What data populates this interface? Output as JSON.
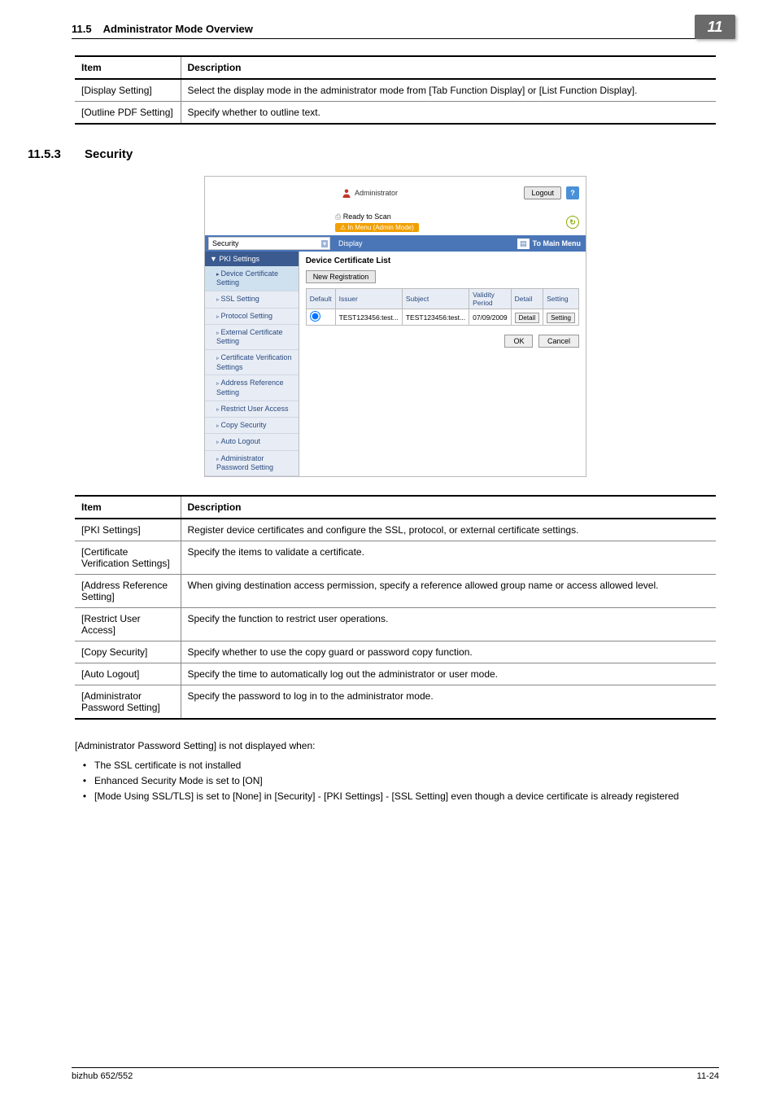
{
  "header": {
    "section_no": "11.5",
    "section_title": "Administrator Mode Overview",
    "chapter_badge": "11"
  },
  "table1": {
    "head": {
      "item": "Item",
      "desc": "Description"
    },
    "rows": [
      {
        "item": "[Display Setting]",
        "desc": "Select the display mode in the administrator mode from [Tab Function Display] or [List Function Display]."
      },
      {
        "item": "[Outline PDF Setting]",
        "desc": "Specify whether to outline text."
      }
    ]
  },
  "subsection": {
    "num": "11.5.3",
    "title": "Security"
  },
  "screenshot": {
    "admin_label": "Administrator",
    "logout": "Logout",
    "help": "?",
    "status_ready": "Ready to Scan",
    "status_menu": "In Menu (Admin Mode)",
    "dropdown": "Security",
    "display_btn": "Display",
    "to_main": "To Main Menu",
    "sidebar": {
      "group": "PKI Settings",
      "items": [
        "Device Certificate Setting",
        "SSL Setting",
        "Protocol Setting",
        "External Certificate Setting",
        "Certificate Verification Settings",
        "Address Reference Setting",
        "Restrict User Access",
        "Copy Security",
        "Auto Logout",
        "Administrator Password Setting"
      ]
    },
    "main": {
      "title": "Device Certificate List",
      "new_reg": "New Registration",
      "cols": {
        "default": "Default",
        "issuer": "Issuer",
        "subject": "Subject",
        "validity": "Validity Period",
        "detail": "Detail",
        "setting": "Setting"
      },
      "row": {
        "issuer": "TEST123456:test...",
        "subject": "TEST123456:test...",
        "validity": "07/09/2009",
        "detail": "Detail",
        "setting": "Setting"
      },
      "ok": "OK",
      "cancel": "Cancel"
    }
  },
  "table2": {
    "head": {
      "item": "Item",
      "desc": "Description"
    },
    "rows": [
      {
        "item": "[PKI Settings]",
        "desc": "Register device certificates and configure the SSL, protocol, or external certificate settings."
      },
      {
        "item": "[Certificate Verification Settings]",
        "desc": "Specify the items to validate a certificate."
      },
      {
        "item": "[Address Reference Setting]",
        "desc": "When giving destination access permission, specify a reference allowed group name or access allowed level."
      },
      {
        "item": "[Restrict User Access]",
        "desc": "Specify the function to restrict user operations."
      },
      {
        "item": "[Copy Security]",
        "desc": "Specify whether to use the copy guard or password copy function."
      },
      {
        "item": "[Auto Logout]",
        "desc": "Specify the time to automatically log out the administrator or user mode."
      },
      {
        "item": "[Administrator Password Setting]",
        "desc": "Specify the password to log in to the administrator mode."
      }
    ]
  },
  "note": "[Administrator Password Setting] is not displayed when:",
  "bullets": [
    "The SSL certificate is not installed",
    "Enhanced Security Mode is set to [ON]",
    "[Mode Using SSL/TLS] is set to [None] in [Security] - [PKI Settings] - [SSL Setting] even though a device certificate is already registered"
  ],
  "footer": {
    "left": "bizhub 652/552",
    "right": "11-24"
  }
}
